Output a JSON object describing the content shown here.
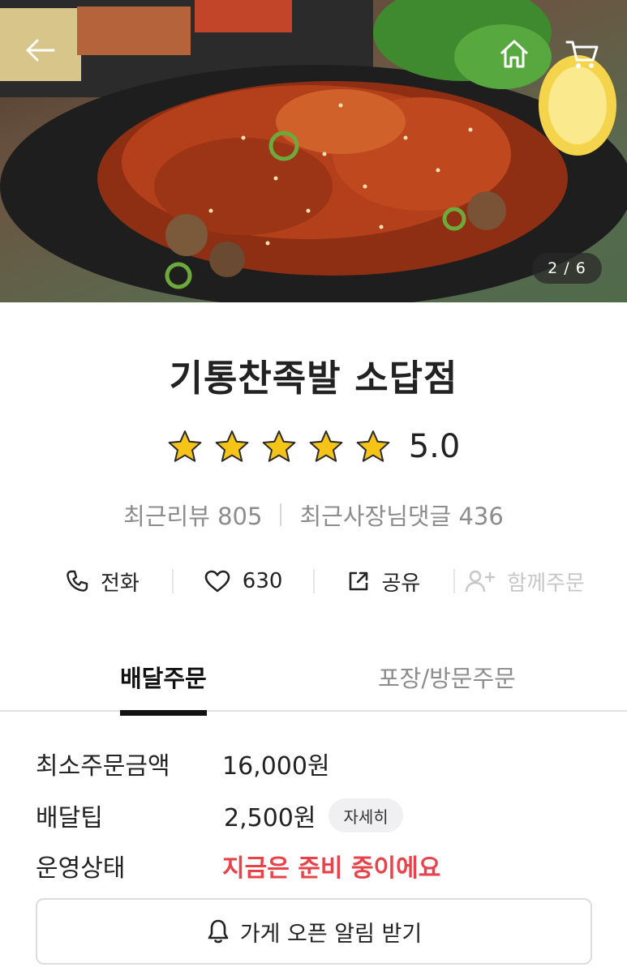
{
  "hero": {
    "image_counter": "2 / 6",
    "icons": {
      "back": "back-arrow-icon",
      "home": "home-icon",
      "cart": "cart-icon"
    }
  },
  "store": {
    "name": "기통찬족발 소답점",
    "rating_value": "5.0",
    "rating_stars": 5,
    "recent_reviews": "최근리뷰 805",
    "owner_replies": "최근사장님댓글 436"
  },
  "actions": {
    "call": "전화",
    "likes": "630",
    "share": "공유",
    "group_order": "함께주문"
  },
  "tabs": {
    "delivery": "배달주문",
    "pickup": "포장/방문주문",
    "active": "delivery"
  },
  "info": {
    "min_order_label": "최소주문금액",
    "min_order_value": "16,000원",
    "delivery_tip_label": "배달팁",
    "delivery_tip_value": "2,500원",
    "detail_button": "자세히",
    "status_label": "운영상태",
    "status_value": "지금은 준비 중이에요"
  },
  "notify_button": "가게 오픈 알림 받기",
  "colors": {
    "status_red": "#e8434a",
    "star_yellow": "#f6c417",
    "text_primary": "#222222",
    "text_muted": "#8c8c8c"
  }
}
